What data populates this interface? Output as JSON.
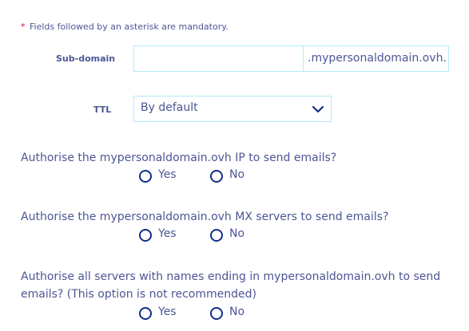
{
  "note": {
    "asterisk": "*",
    "text": "Fields followed by an asterisk are mandatory."
  },
  "subdomain": {
    "label": "Sub-domain",
    "value": "",
    "placeholder": "",
    "suffix": ".mypersonaldomain.ovh."
  },
  "ttl": {
    "label": "TTL",
    "selected": "By default",
    "icon": "chevron-down-icon"
  },
  "questions": [
    {
      "text": "Authorise the mypersonaldomain.ovh IP to send emails?",
      "options": [
        "Yes",
        "No"
      ]
    },
    {
      "text": "Authorise the mypersonaldomain.ovh MX servers to send emails?",
      "options": [
        "Yes",
        "No"
      ]
    },
    {
      "text": "Authorise all servers with names ending in mypersonaldomain.ovh to send emails? (This option is not recommended)",
      "options": [
        "Yes",
        "No"
      ]
    }
  ],
  "colors": {
    "text": "#4d5693",
    "asterisk": "#e0005a",
    "border": "#b3ebf5",
    "radio": "#122e8a"
  }
}
